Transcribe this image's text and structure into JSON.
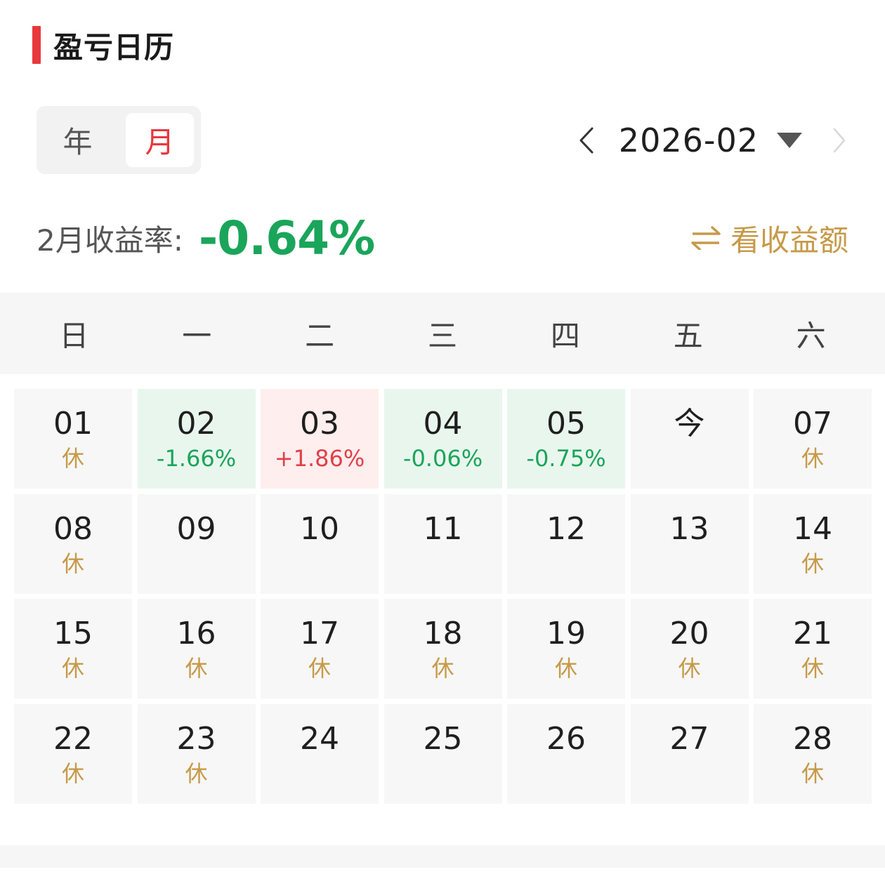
{
  "header": {
    "title": "盈亏日历",
    "accent_color": "#e8383d"
  },
  "toggle": {
    "year_label": "年",
    "month_label": "月",
    "selected": "月"
  },
  "nav": {
    "prev_icon": "chevron-left-icon",
    "month": "2026-02",
    "dropdown_icon": "caret-down-icon",
    "next_icon": "chevron-right-icon"
  },
  "summary": {
    "label": "2月收益率:",
    "value": "-0.64%",
    "value_color": "#1aa55a",
    "switch_icon": "swap-arrows-icon",
    "switch_label": "看收益额"
  },
  "weekdays": [
    "日",
    "一",
    "二",
    "三",
    "四",
    "五",
    "六"
  ],
  "days": [
    {
      "day": "01",
      "sub": "休",
      "status": "rest"
    },
    {
      "day": "02",
      "sub": "-1.66%",
      "status": "loss"
    },
    {
      "day": "03",
      "sub": "+1.86%",
      "status": "gain"
    },
    {
      "day": "04",
      "sub": "-0.06%",
      "status": "loss"
    },
    {
      "day": "05",
      "sub": "-0.75%",
      "status": "loss"
    },
    {
      "day": "今",
      "sub": "",
      "status": "today"
    },
    {
      "day": "07",
      "sub": "休",
      "status": "rest"
    },
    {
      "day": "08",
      "sub": "休",
      "status": "rest"
    },
    {
      "day": "09",
      "sub": "",
      "status": "none"
    },
    {
      "day": "10",
      "sub": "",
      "status": "none"
    },
    {
      "day": "11",
      "sub": "",
      "status": "none"
    },
    {
      "day": "12",
      "sub": "",
      "status": "none"
    },
    {
      "day": "13",
      "sub": "",
      "status": "none"
    },
    {
      "day": "14",
      "sub": "休",
      "status": "rest"
    },
    {
      "day": "15",
      "sub": "休",
      "status": "rest"
    },
    {
      "day": "16",
      "sub": "休",
      "status": "rest"
    },
    {
      "day": "17",
      "sub": "休",
      "status": "rest"
    },
    {
      "day": "18",
      "sub": "休",
      "status": "rest"
    },
    {
      "day": "19",
      "sub": "休",
      "status": "rest"
    },
    {
      "day": "20",
      "sub": "休",
      "status": "rest"
    },
    {
      "day": "21",
      "sub": "休",
      "status": "rest"
    },
    {
      "day": "22",
      "sub": "休",
      "status": "rest"
    },
    {
      "day": "23",
      "sub": "休",
      "status": "rest"
    },
    {
      "day": "24",
      "sub": "",
      "status": "none"
    },
    {
      "day": "25",
      "sub": "",
      "status": "none"
    },
    {
      "day": "26",
      "sub": "",
      "status": "none"
    },
    {
      "day": "27",
      "sub": "",
      "status": "none"
    },
    {
      "day": "28",
      "sub": "休",
      "status": "rest"
    }
  ],
  "colors": {
    "gain_text": "#e04048",
    "gain_bg": "#ffeeee",
    "loss_text": "#1aa55a",
    "loss_bg": "#e9f6ee",
    "rest_text": "#c69a4a"
  }
}
